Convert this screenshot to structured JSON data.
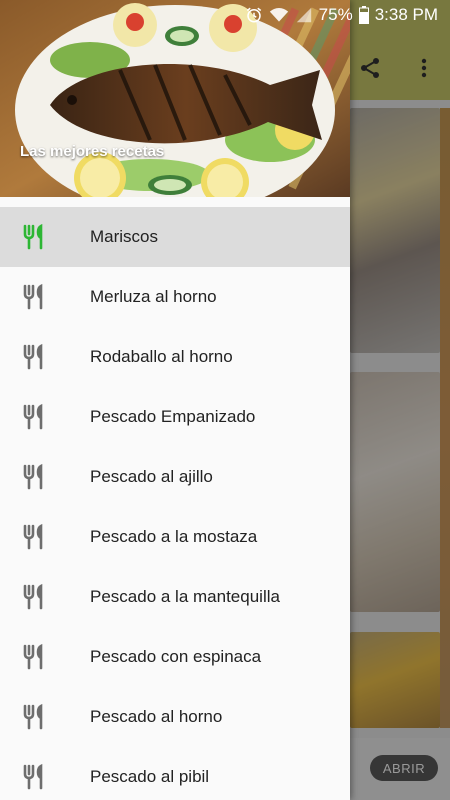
{
  "status_bar": {
    "battery_percent": "75%",
    "time": "3:38 PM"
  },
  "drawer": {
    "header_title": "Las mejores recetas",
    "items": [
      {
        "label": "Mariscos",
        "active": true
      },
      {
        "label": "Merluza al horno",
        "active": false
      },
      {
        "label": "Rodaballo al horno",
        "active": false
      },
      {
        "label": "Pescado Empanizado",
        "active": false
      },
      {
        "label": "Pescado al ajillo",
        "active": false
      },
      {
        "label": "Pescado a la mostaza",
        "active": false
      },
      {
        "label": "Pescado a la mantequilla",
        "active": false
      },
      {
        "label": "Pescado con espinaca",
        "active": false
      },
      {
        "label": "Pescado al horno",
        "active": false
      },
      {
        "label": "Pescado al pibil",
        "active": false
      }
    ]
  },
  "background": {
    "open_button_label": "ABRIR",
    "toolbar_color": "#c9c96a"
  },
  "colors": {
    "active_icon": "#2db634",
    "inactive_icon": "#6d6d6d"
  }
}
